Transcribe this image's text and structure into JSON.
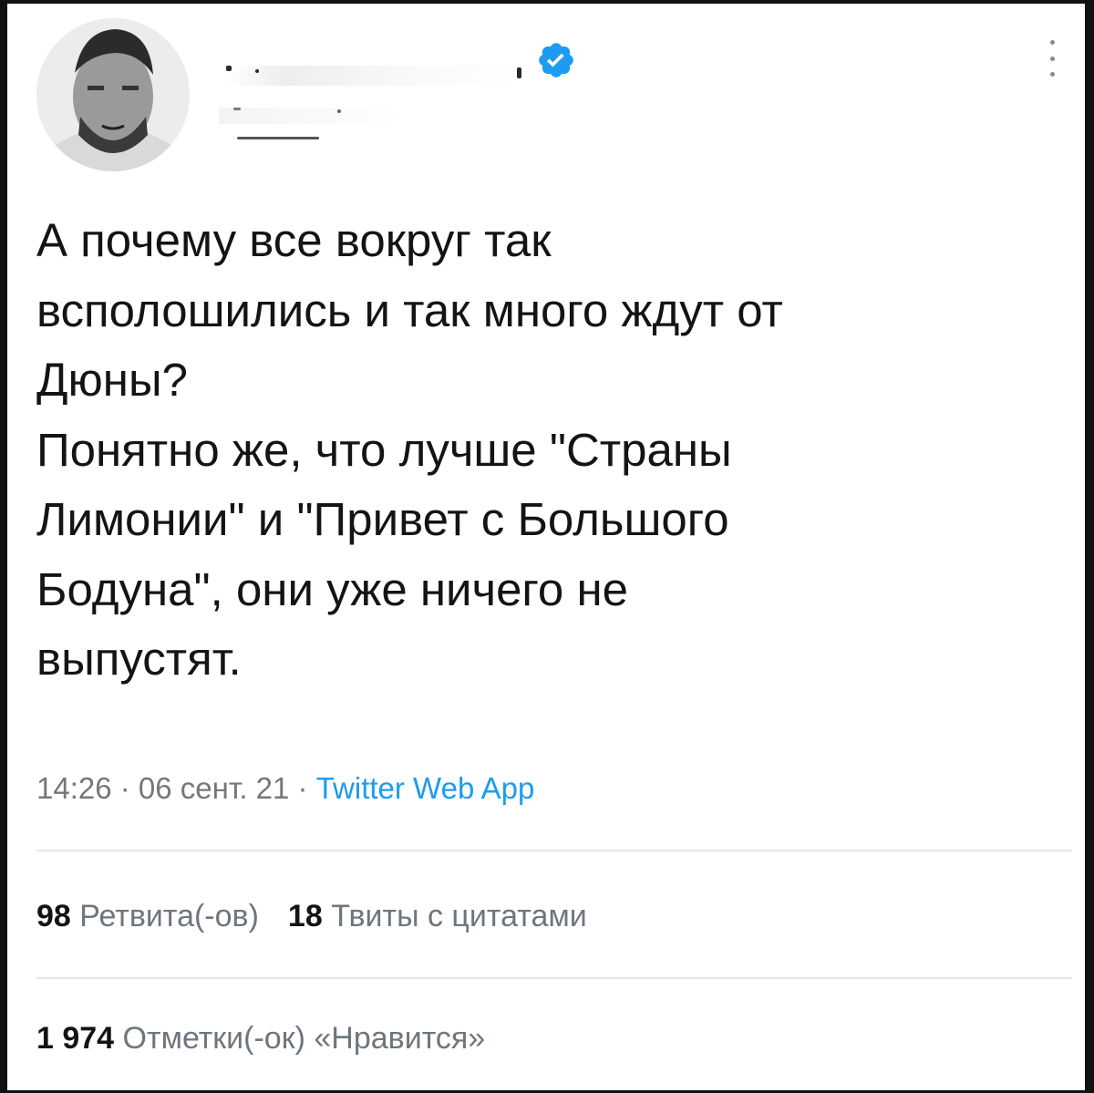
{
  "tweet": {
    "text": "А почему все вокруг так\nвсполошились и так много ждут от\nДюны?\nПонятно же, что лучше \"Страны\nЛимонии\" и \"Привет с Большого\nБодуна\", они уже ничего не\nвыпустят.",
    "time": "14:26",
    "date": "06 сент. 21",
    "source": "Twitter Web App",
    "separator": " · "
  },
  "stats": {
    "retweets_count": "98",
    "retweets_label": "Ретвита(-ов)",
    "quotes_count": "18",
    "quotes_label": "Твиты с цитатами",
    "likes_count": "1 974",
    "likes_label": "Отметки(-ок) «Нравится»"
  },
  "icons": {
    "verified": "verified-badge-icon",
    "more": "more-vertical-icon"
  },
  "colors": {
    "accent": "#1d9bf0",
    "text": "#141414",
    "muted": "#6e767d"
  }
}
